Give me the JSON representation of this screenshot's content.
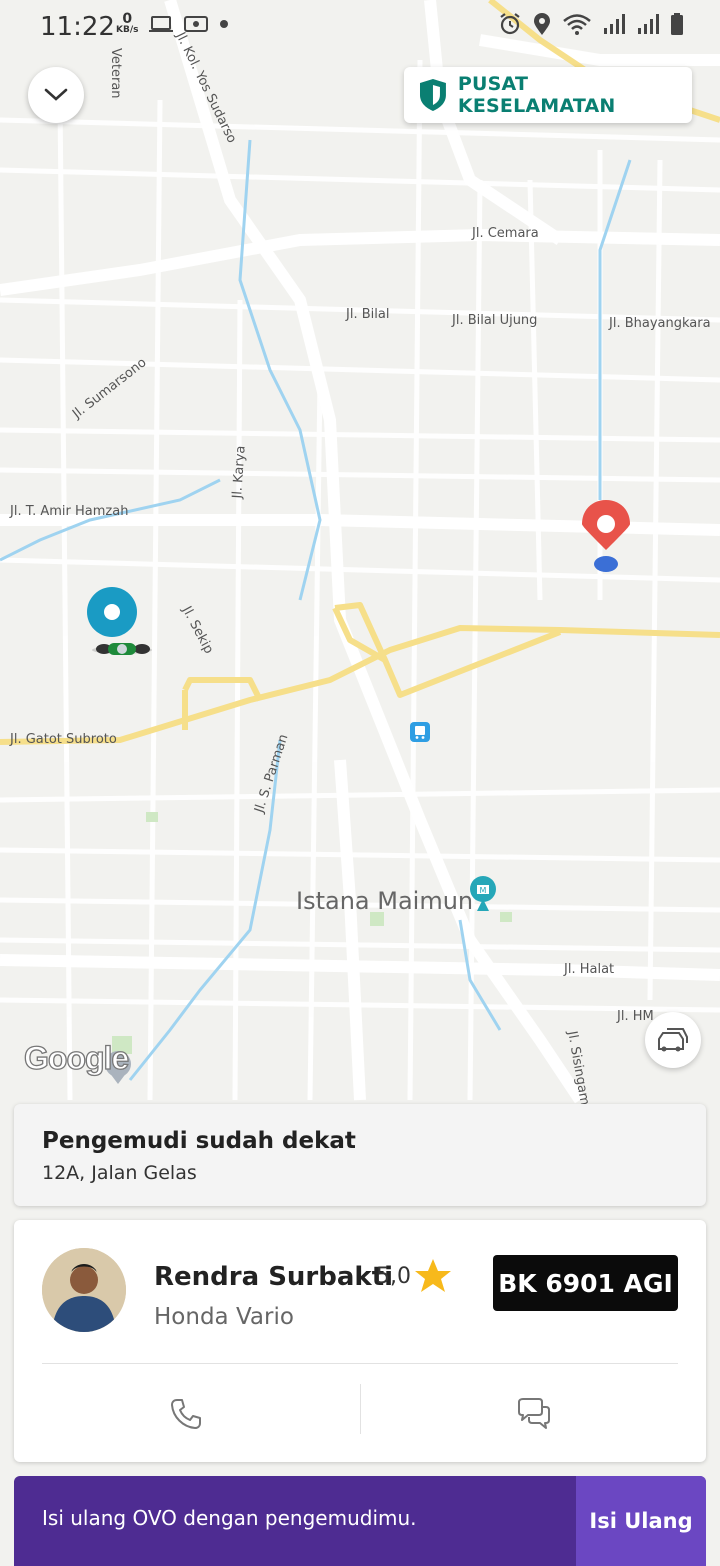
{
  "status_bar": {
    "time": "11:22",
    "net_speed_value": "0",
    "net_speed_unit": "KB/s"
  },
  "header": {
    "safety_label": "PUSAT KESELAMATAN"
  },
  "map": {
    "streets": [
      "Veteran",
      "Jl. Kol. Yos Sudarso",
      "Jl. Cemara",
      "Jl. Bilal",
      "Jl. Bilal Ujung",
      "Jl. Bhayangkara",
      "Jl. Sumarsono",
      "Jl. Karya",
      "Jl. T. Amir Hamzah",
      "Jl. Sekip",
      "Jl. Gatot Subroto",
      "Jl. S. Parman",
      "Jl. Halat",
      "Jl. HM",
      "Jl. Sisingam"
    ],
    "landmark": "Istana Maimun",
    "attribution": "Google",
    "colors": {
      "background": "#f2f2ef",
      "road": "#ffffff",
      "major_road": "#f6df8a",
      "water": "#9fd3f0",
      "pickup": "#1a9bc4",
      "destination": "#e8534a"
    }
  },
  "trip_status": {
    "title": "Pengemudi sudah dekat",
    "address": "12A, Jalan Gelas"
  },
  "driver": {
    "name": "Rendra Surbakti",
    "rating": "5,0",
    "vehicle": "Honda Vario",
    "plate": "BK 6901 AGI"
  },
  "ovo": {
    "message": "Isi ulang OVO dengan pengemudimu.",
    "button": "Isi Ulang"
  }
}
